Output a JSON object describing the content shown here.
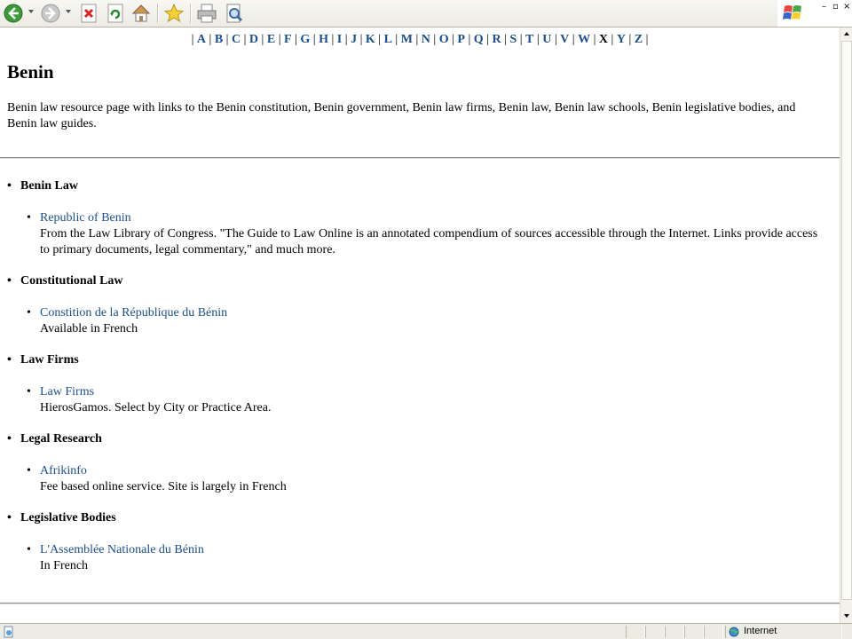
{
  "toolbar": {
    "buttons": [
      "back-button",
      "forward-button",
      "stop-button",
      "refresh-button",
      "home-button",
      "favorites-button",
      "print-button",
      "print-preview-button"
    ]
  },
  "alphabet": {
    "letters": [
      "A",
      "B",
      "C",
      "D",
      "E",
      "F",
      "G",
      "H",
      "I",
      "J",
      "K",
      "L",
      "M",
      "N",
      "O",
      "P",
      "Q",
      "R",
      "S",
      "T",
      "U",
      "V",
      "W",
      "X",
      "Y",
      "Z"
    ],
    "current": "X"
  },
  "page": {
    "title": "Benin",
    "intro": "Benin law resource page with links to the Benin constitution, Benin government, Benin law firms, Benin law, Benin law schools, Benin legislative bodies, and Benin law guides."
  },
  "sections": [
    {
      "heading": "Benin Law",
      "link": "Republic of Benin",
      "desc": "From the Law Library of Congress. \"The Guide to Law Online is an annotated compendium of sources accessible through the Internet. Links provide access to primary documents, legal commentary,\" and much more."
    },
    {
      "heading": "Constitutional Law",
      "link": "Constition de la République du Bénin",
      "desc": "Available in French"
    },
    {
      "heading": "Law Firms",
      "link": "Law Firms",
      "desc": "HierosGamos. Select by City or Practice Area."
    },
    {
      "heading": "Legal Research",
      "link": "Afrikinfo",
      "desc": "Fee based online service. Site is largely in French"
    },
    {
      "heading": "Legislative Bodies",
      "link": "L'Assemblée Nationale du Bénin",
      "desc": "In French"
    }
  ],
  "status": {
    "zone": "Internet"
  },
  "colors": {
    "link": "#1a4f8f",
    "toolbar": "#ecebe4"
  }
}
